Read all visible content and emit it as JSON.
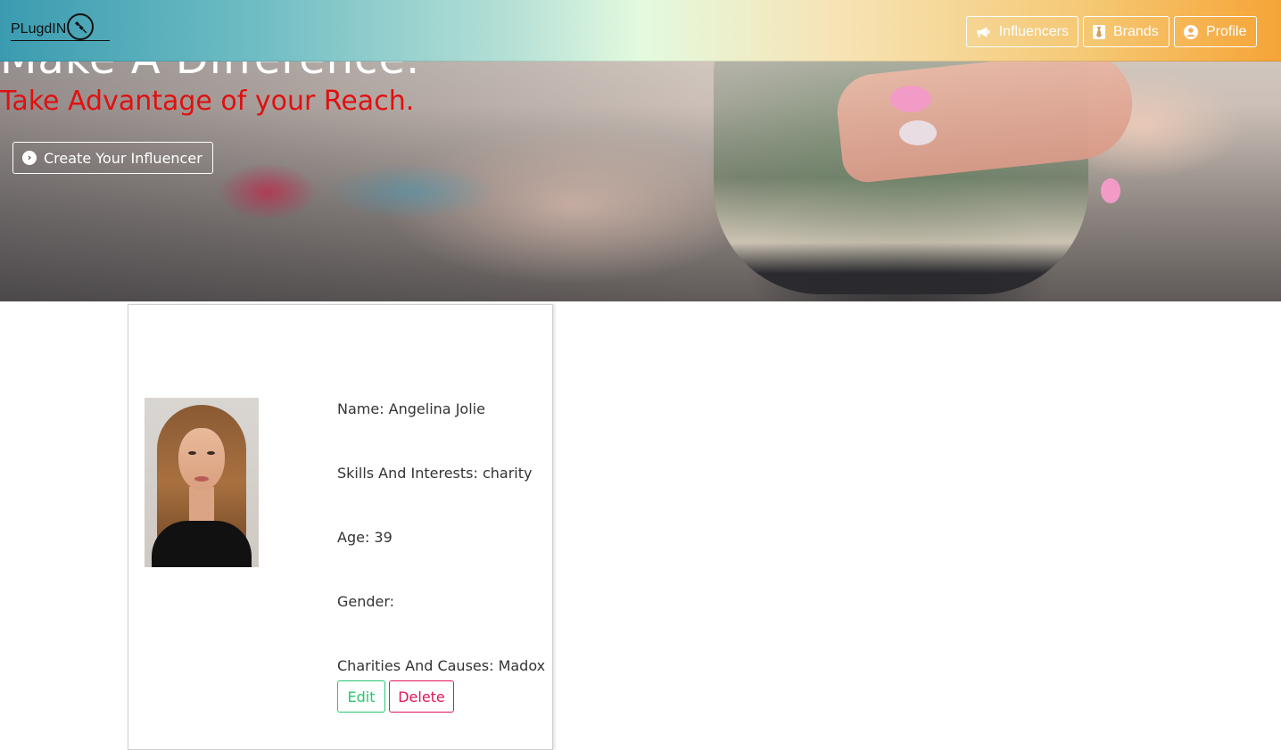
{
  "navbar": {
    "brand": "PLugdIN",
    "items": [
      {
        "label": "Influencers",
        "icon": "bullhorn-icon"
      },
      {
        "label": "Brands",
        "icon": "tie-icon"
      },
      {
        "label": "Profile",
        "icon": "user-circle-icon"
      }
    ]
  },
  "hero": {
    "title": "Make A Difference.",
    "subtitle": "Take Advantage of your Reach.",
    "cta_label": "Create Your Influencer",
    "subtitle_color": "#e01010"
  },
  "card": {
    "name": "Name: Angelina Jolie",
    "skills": "Skills And Interests: charity",
    "age": "Age: 39",
    "gender": "Gender:",
    "charities": "Charities And Causes: Madox",
    "edit_label": "Edit",
    "delete_label": "Delete"
  },
  "colors": {
    "edit": "#28c76f",
    "delete": "#e0155a",
    "nav_gradient_start": "#3a9bb0",
    "nav_gradient_end": "#f6a436"
  }
}
